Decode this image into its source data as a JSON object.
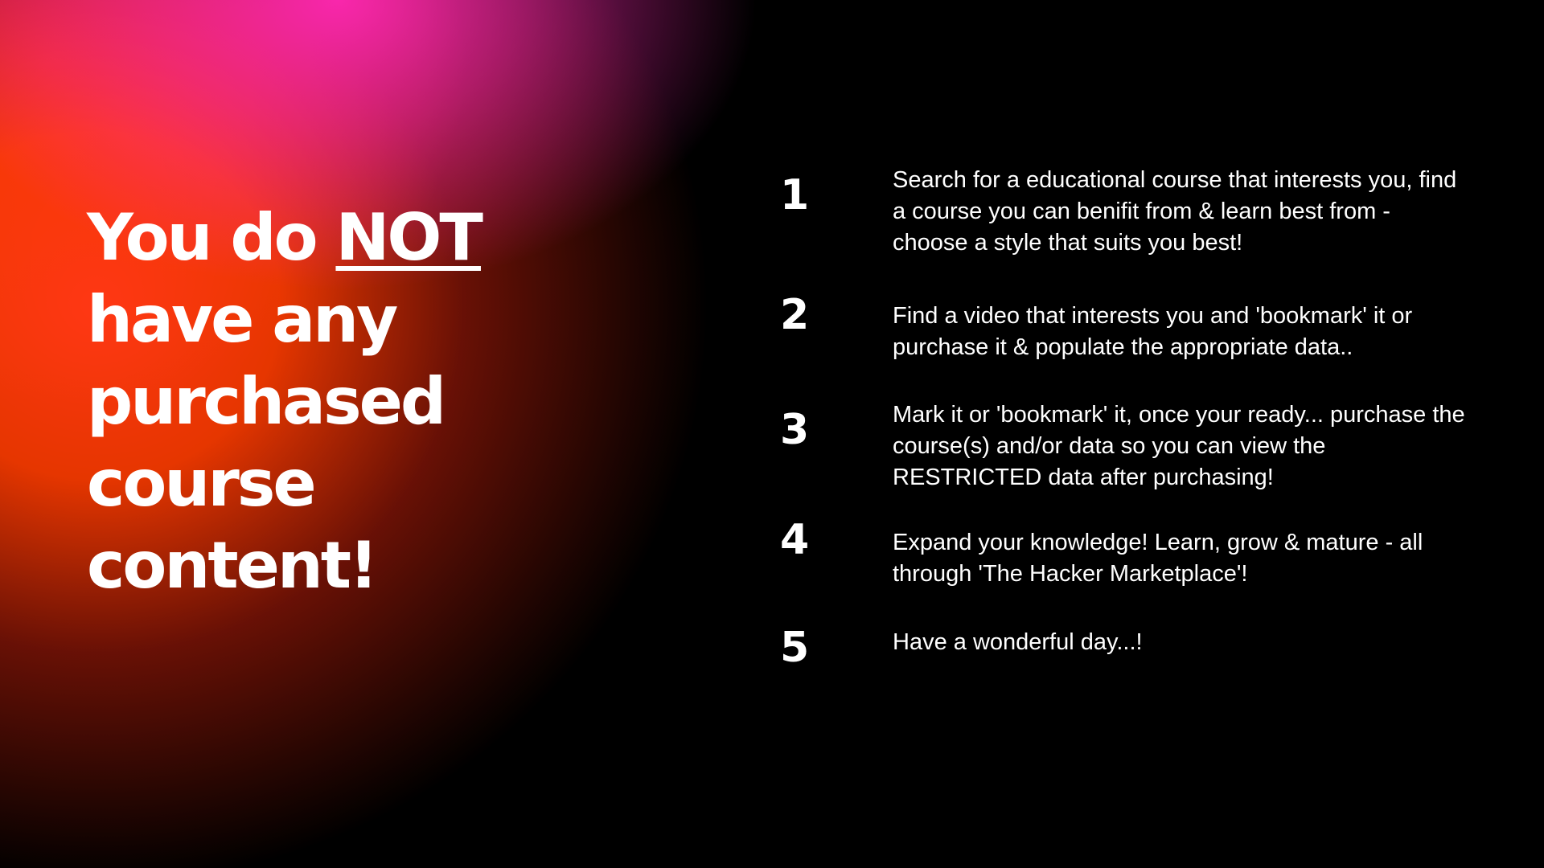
{
  "headline": {
    "line1_prefix": "You do ",
    "line1_emphasis": "NOT",
    "line2": "have any",
    "line3": "purchased",
    "line4": "course",
    "line5": "content!"
  },
  "steps": [
    {
      "number": "1",
      "text": "Search for a educational course that interests you, find a course you can benifit from & learn best from - choose a style that suits you best!"
    },
    {
      "number": "2",
      "text": "Find a video that interests you and 'bookmark' it or purchase it & populate the appropriate data.."
    },
    {
      "number": "3",
      "text": "Mark it or 'bookmark' it, once your ready... purchase the course(s) and/or data so you can view the RESTRICTED data after purchasing!"
    },
    {
      "number": "4",
      "text": "Expand your knowledge! Learn, grow & mature - all through 'The Hacker Marketplace'!"
    },
    {
      "number": "5",
      "text": "Have a wonderful day...!"
    }
  ],
  "colors": {
    "background": "#000000",
    "glow_pink": "#ff28b4",
    "glow_orange": "#ff3c00",
    "text": "#ffffff"
  }
}
